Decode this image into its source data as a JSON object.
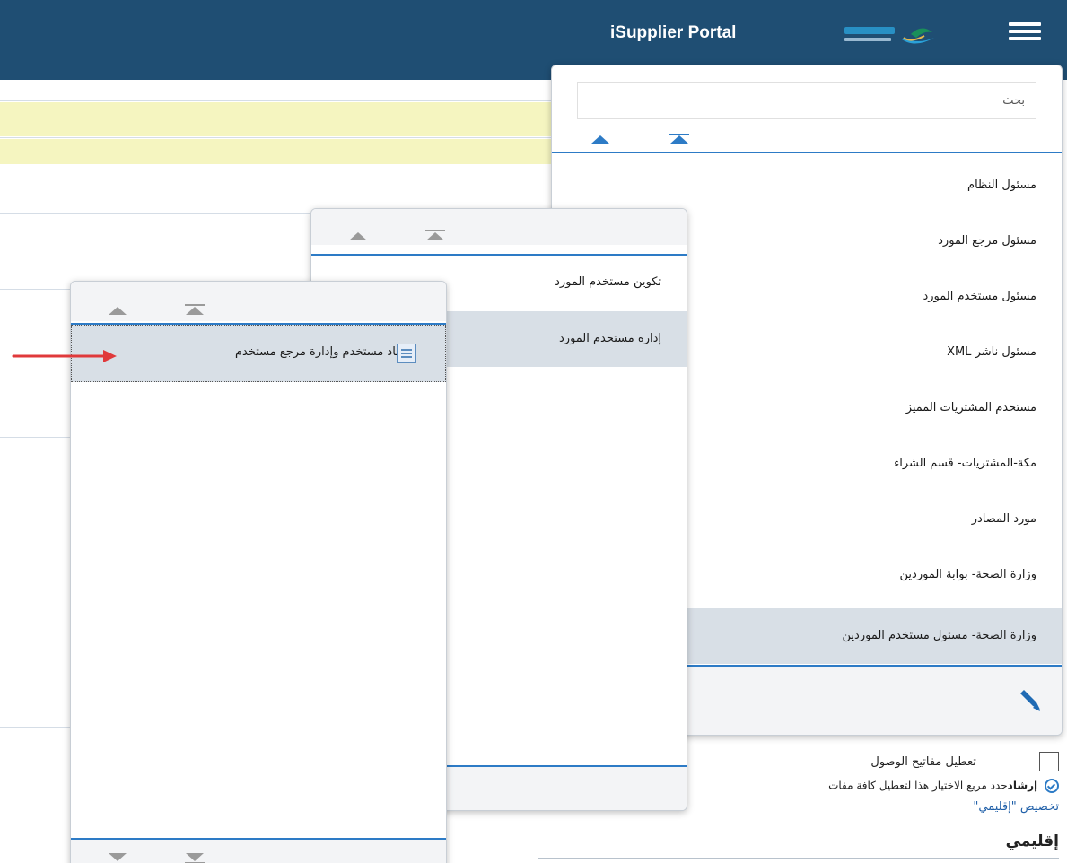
{
  "header": {
    "title": "iSupplier Portal"
  },
  "main_menu": {
    "search_placeholder": "بحث",
    "items": [
      {
        "label": "مسئول النظام"
      },
      {
        "label": "مسئول مرجع المورد"
      },
      {
        "label": "مسئول مستخدم المورد"
      },
      {
        "label": "مسئول ناشر XML"
      },
      {
        "label": "مستخدم المشتريات المميز"
      },
      {
        "label": "مكة-المشتريات- قسم الشراء"
      },
      {
        "label": "مورد المصادر"
      },
      {
        "label": "وزارة الصحة- بوابة الموردين"
      },
      {
        "label": "وزارة الصحة- مسئول مستخدم الموردين"
      }
    ]
  },
  "sub_menu": {
    "items": [
      {
        "label": "تكوين مستخدم المورد"
      },
      {
        "label": "إدارة مستخدم المورد"
      }
    ]
  },
  "sub_sub_menu": {
    "items": [
      {
        "label": "اعتماد مستخدم وإدارة مرجع مستخدم"
      }
    ]
  },
  "bottom": {
    "checkbox_label": "تعطيل مفاتيح الوصول",
    "tip_bold": "إرشاد",
    "tip_text": "حدد مربع الاختيار هذا لتعطيل كافة مفات",
    "link_text": "تخصيص \"إقليمي\"",
    "section_heading": "إقليمي"
  },
  "colors": {
    "header_bg": "#1f4e73",
    "accent_blue": "#2d7bc6",
    "selected_bg": "#d8dfe6",
    "highlight_yellow": "#f5f5c0",
    "arrow_red": "#e0393b"
  }
}
